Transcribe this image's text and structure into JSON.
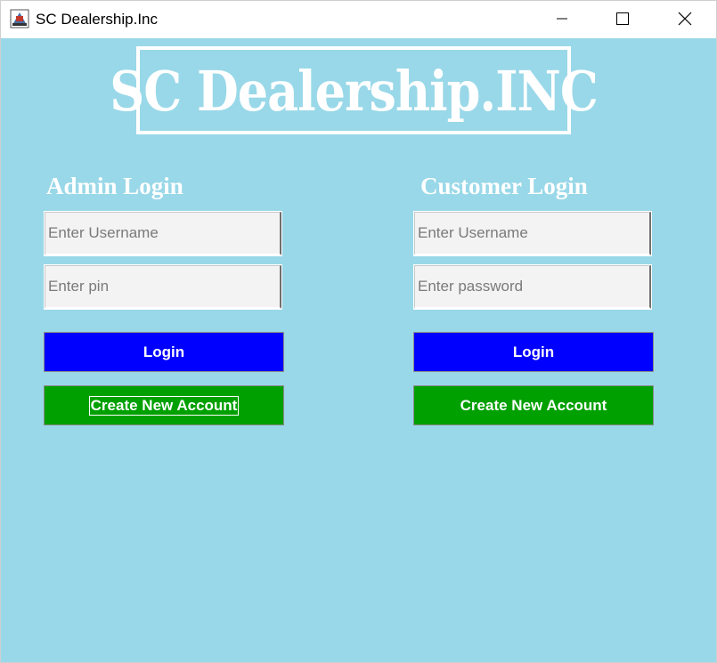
{
  "window": {
    "title": "SC Dealership.Inc"
  },
  "banner": {
    "text": "SC Dealership.INC"
  },
  "admin": {
    "heading": "Admin Login",
    "username_placeholder": "Enter Username",
    "pin_placeholder": "Enter pin",
    "login_label": "Login",
    "create_label": "Create New Account"
  },
  "customer": {
    "heading": "Customer Login",
    "username_placeholder": "Enter Username",
    "password_placeholder": "Enter password",
    "login_label": "Login",
    "create_label": "Create New Account"
  },
  "colors": {
    "background": "#99d8e8",
    "login_button": "#0000ff",
    "create_button": "#00a000",
    "text_light": "#ffffff"
  },
  "icons": {
    "app": "java-app-icon",
    "minimize": "minimize-icon",
    "maximize": "maximize-icon",
    "close": "close-icon"
  }
}
